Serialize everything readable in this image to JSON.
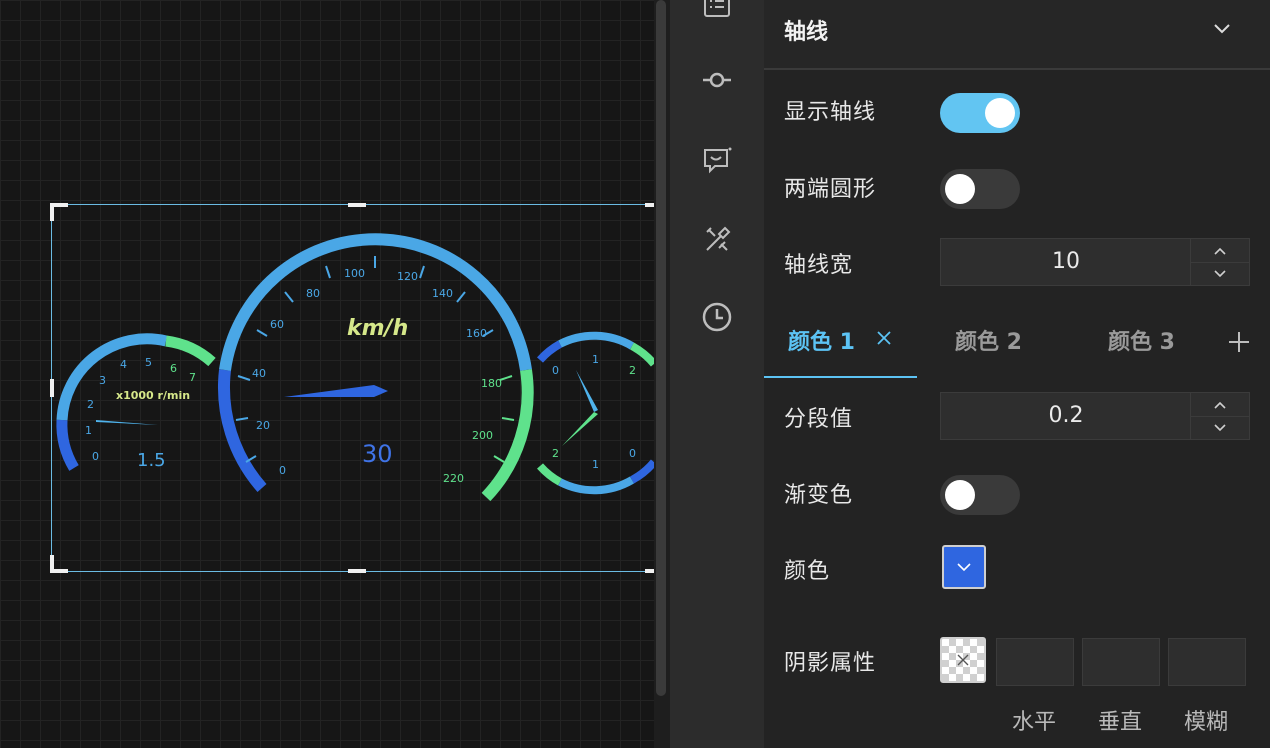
{
  "canvas": {
    "gauges": {
      "rpm": {
        "unit_label": "x1000 r/min",
        "value_label": "1.5",
        "ticks": [
          "0",
          "1",
          "2",
          "3",
          "4",
          "5",
          "6",
          "7"
        ]
      },
      "speed": {
        "unit_label": "km/h",
        "value_label": "30",
        "ticks": [
          "0",
          "20",
          "40",
          "60",
          "80",
          "100",
          "120",
          "140",
          "160",
          "180",
          "200",
          "220"
        ]
      },
      "dual": {
        "top_ticks": [
          "0",
          "1",
          "2"
        ],
        "bottom_ticks": [
          "2",
          "1",
          "0"
        ]
      }
    }
  },
  "rail": {
    "icons": [
      "list-icon",
      "commit-icon",
      "chat-bubble-icon",
      "tools-icon",
      "clock-icon"
    ]
  },
  "panel": {
    "section_title": "轴线",
    "show_axis": {
      "label": "显示轴线",
      "on": true
    },
    "round_ends": {
      "label": "两端圆形",
      "on": false
    },
    "axis_width": {
      "label": "轴线宽",
      "value": "10"
    },
    "tabs": [
      {
        "label": "颜色 1",
        "active": true
      },
      {
        "label": "颜色 2",
        "active": false
      },
      {
        "label": "颜色 3",
        "active": false
      }
    ],
    "segment": {
      "label": "分段值",
      "value": "0.2"
    },
    "gradient": {
      "label": "渐变色",
      "on": false
    },
    "color": {
      "label": "颜色",
      "value": "#2f66e0"
    },
    "shadow": {
      "label": "阴影属性",
      "captions": [
        "水平",
        "垂直",
        "模糊"
      ]
    }
  },
  "colors": {
    "accent": "#5cc3f4",
    "gauge_blue": "#2f66e0",
    "gauge_cyan": "#4aa7e6",
    "gauge_green": "#5fe28c"
  }
}
